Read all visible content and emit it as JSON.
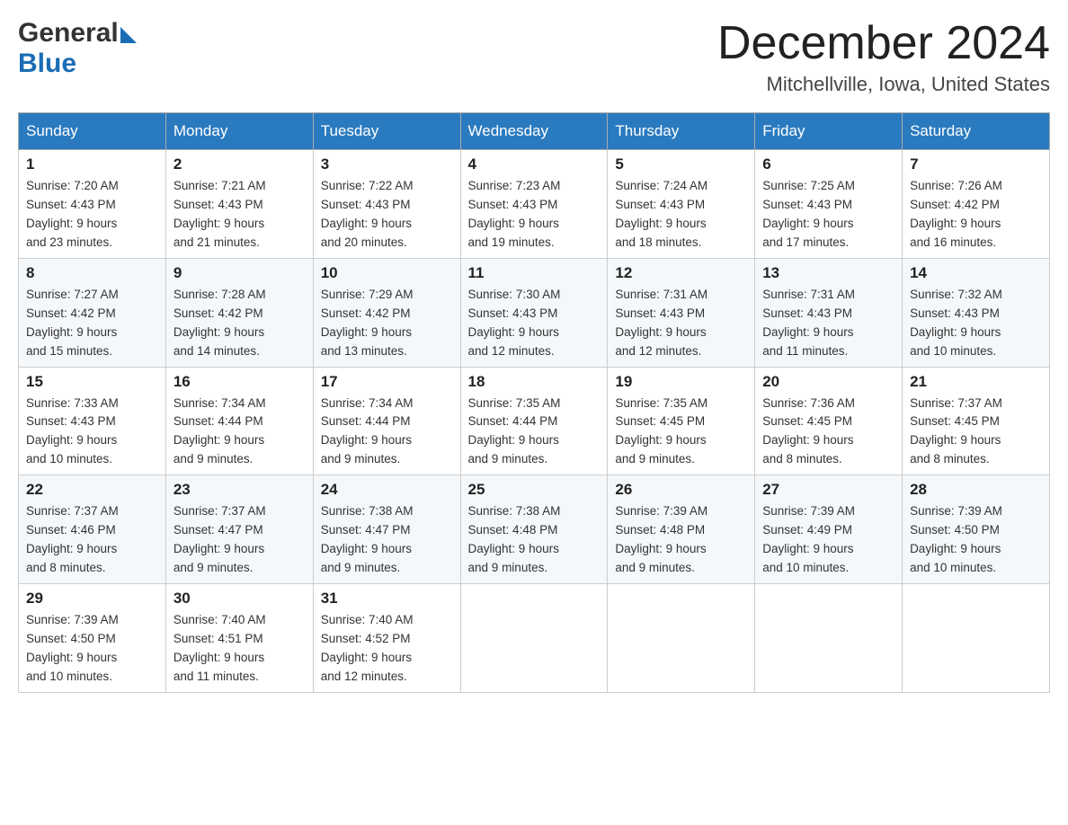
{
  "logo": {
    "general": "General",
    "blue": "Blue"
  },
  "title": {
    "month": "December 2024",
    "location": "Mitchellville, Iowa, United States"
  },
  "headers": [
    "Sunday",
    "Monday",
    "Tuesday",
    "Wednesday",
    "Thursday",
    "Friday",
    "Saturday"
  ],
  "weeks": [
    [
      {
        "day": "1",
        "sunrise": "7:20 AM",
        "sunset": "4:43 PM",
        "daylight": "9 hours and 23 minutes."
      },
      {
        "day": "2",
        "sunrise": "7:21 AM",
        "sunset": "4:43 PM",
        "daylight": "9 hours and 21 minutes."
      },
      {
        "day": "3",
        "sunrise": "7:22 AM",
        "sunset": "4:43 PM",
        "daylight": "9 hours and 20 minutes."
      },
      {
        "day": "4",
        "sunrise": "7:23 AM",
        "sunset": "4:43 PM",
        "daylight": "9 hours and 19 minutes."
      },
      {
        "day": "5",
        "sunrise": "7:24 AM",
        "sunset": "4:43 PM",
        "daylight": "9 hours and 18 minutes."
      },
      {
        "day": "6",
        "sunrise": "7:25 AM",
        "sunset": "4:43 PM",
        "daylight": "9 hours and 17 minutes."
      },
      {
        "day": "7",
        "sunrise": "7:26 AM",
        "sunset": "4:42 PM",
        "daylight": "9 hours and 16 minutes."
      }
    ],
    [
      {
        "day": "8",
        "sunrise": "7:27 AM",
        "sunset": "4:42 PM",
        "daylight": "9 hours and 15 minutes."
      },
      {
        "day": "9",
        "sunrise": "7:28 AM",
        "sunset": "4:42 PM",
        "daylight": "9 hours and 14 minutes."
      },
      {
        "day": "10",
        "sunrise": "7:29 AM",
        "sunset": "4:42 PM",
        "daylight": "9 hours and 13 minutes."
      },
      {
        "day": "11",
        "sunrise": "7:30 AM",
        "sunset": "4:43 PM",
        "daylight": "9 hours and 12 minutes."
      },
      {
        "day": "12",
        "sunrise": "7:31 AM",
        "sunset": "4:43 PM",
        "daylight": "9 hours and 12 minutes."
      },
      {
        "day": "13",
        "sunrise": "7:31 AM",
        "sunset": "4:43 PM",
        "daylight": "9 hours and 11 minutes."
      },
      {
        "day": "14",
        "sunrise": "7:32 AM",
        "sunset": "4:43 PM",
        "daylight": "9 hours and 10 minutes."
      }
    ],
    [
      {
        "day": "15",
        "sunrise": "7:33 AM",
        "sunset": "4:43 PM",
        "daylight": "9 hours and 10 minutes."
      },
      {
        "day": "16",
        "sunrise": "7:34 AM",
        "sunset": "4:44 PM",
        "daylight": "9 hours and 9 minutes."
      },
      {
        "day": "17",
        "sunrise": "7:34 AM",
        "sunset": "4:44 PM",
        "daylight": "9 hours and 9 minutes."
      },
      {
        "day": "18",
        "sunrise": "7:35 AM",
        "sunset": "4:44 PM",
        "daylight": "9 hours and 9 minutes."
      },
      {
        "day": "19",
        "sunrise": "7:35 AM",
        "sunset": "4:45 PM",
        "daylight": "9 hours and 9 minutes."
      },
      {
        "day": "20",
        "sunrise": "7:36 AM",
        "sunset": "4:45 PM",
        "daylight": "9 hours and 8 minutes."
      },
      {
        "day": "21",
        "sunrise": "7:37 AM",
        "sunset": "4:45 PM",
        "daylight": "9 hours and 8 minutes."
      }
    ],
    [
      {
        "day": "22",
        "sunrise": "7:37 AM",
        "sunset": "4:46 PM",
        "daylight": "9 hours and 8 minutes."
      },
      {
        "day": "23",
        "sunrise": "7:37 AM",
        "sunset": "4:47 PM",
        "daylight": "9 hours and 9 minutes."
      },
      {
        "day": "24",
        "sunrise": "7:38 AM",
        "sunset": "4:47 PM",
        "daylight": "9 hours and 9 minutes."
      },
      {
        "day": "25",
        "sunrise": "7:38 AM",
        "sunset": "4:48 PM",
        "daylight": "9 hours and 9 minutes."
      },
      {
        "day": "26",
        "sunrise": "7:39 AM",
        "sunset": "4:48 PM",
        "daylight": "9 hours and 9 minutes."
      },
      {
        "day": "27",
        "sunrise": "7:39 AM",
        "sunset": "4:49 PM",
        "daylight": "9 hours and 10 minutes."
      },
      {
        "day": "28",
        "sunrise": "7:39 AM",
        "sunset": "4:50 PM",
        "daylight": "9 hours and 10 minutes."
      }
    ],
    [
      {
        "day": "29",
        "sunrise": "7:39 AM",
        "sunset": "4:50 PM",
        "daylight": "9 hours and 10 minutes."
      },
      {
        "day": "30",
        "sunrise": "7:40 AM",
        "sunset": "4:51 PM",
        "daylight": "9 hours and 11 minutes."
      },
      {
        "day": "31",
        "sunrise": "7:40 AM",
        "sunset": "4:52 PM",
        "daylight": "9 hours and 12 minutes."
      },
      null,
      null,
      null,
      null
    ]
  ],
  "labels": {
    "sunrise": "Sunrise:",
    "sunset": "Sunset:",
    "daylight": "Daylight:"
  }
}
